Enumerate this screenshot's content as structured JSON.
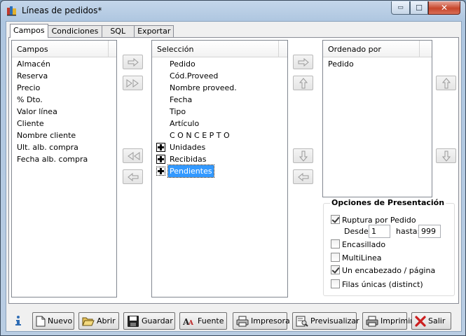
{
  "window": {
    "title": "Líneas de pedidos*",
    "min_glyph": "▭",
    "max_glyph": "☐",
    "close_glyph": "✕"
  },
  "tabs": [
    {
      "label": "Campos",
      "active": true
    },
    {
      "label": "Condiciones",
      "active": false
    },
    {
      "label": "SQL",
      "active": false
    },
    {
      "label": "Exportar",
      "active": false
    }
  ],
  "campos": {
    "header": "Campos",
    "items": [
      "Almacén",
      "Reserva",
      "Precio",
      "% Dto.",
      "Valor línea",
      "Cliente",
      "Nombre cliente",
      "Ult. alb. compra",
      "Fecha alb. compra"
    ]
  },
  "seleccion": {
    "header": "Selección",
    "items": [
      {
        "label": "Pedido",
        "expandable": false
      },
      {
        "label": "Cód.Proveed",
        "expandable": false
      },
      {
        "label": "Nombre proveed.",
        "expandable": false
      },
      {
        "label": "Fecha",
        "expandable": false
      },
      {
        "label": "Tipo",
        "expandable": false
      },
      {
        "label": "Artículo",
        "expandable": false
      },
      {
        "label": "C O N C E P T O",
        "expandable": false
      },
      {
        "label": "Unidades",
        "expandable": true
      },
      {
        "label": "Recibidas",
        "expandable": true
      },
      {
        "label": "Pendientes",
        "expandable": true,
        "selected": true
      }
    ]
  },
  "ordenado": {
    "header": "Ordenado por",
    "items": [
      "Pedido"
    ]
  },
  "opciones": {
    "title": "Opciones de Presentación",
    "ruptura": {
      "label": "Ruptura por Pedido",
      "checked": true
    },
    "desde_label": "Desde:",
    "desde_value": "1",
    "hasta_label": "hasta:",
    "hasta_value": "999",
    "encasillado": {
      "label": "Encasillado",
      "checked": false
    },
    "multilinea": {
      "label": "MultiLinea",
      "checked": false
    },
    "encabezado": {
      "label": "Un encabezado / página",
      "checked": true
    },
    "filas_unicas": {
      "label": "Filas únicas (distinct)",
      "checked": false
    }
  },
  "toolbar": {
    "nuevo": "Nuevo",
    "abrir": "Abrir",
    "guardar": "Guardar",
    "fuente": "Fuente",
    "impresora": "Impresora",
    "previsualizar": "Previsualizar",
    "imprimir": "Imprimir",
    "salir": "Salir"
  },
  "colors": {
    "selection": "#3399ff",
    "close_button": "#c7462b",
    "arrow_gray": "#9a9a9a"
  }
}
